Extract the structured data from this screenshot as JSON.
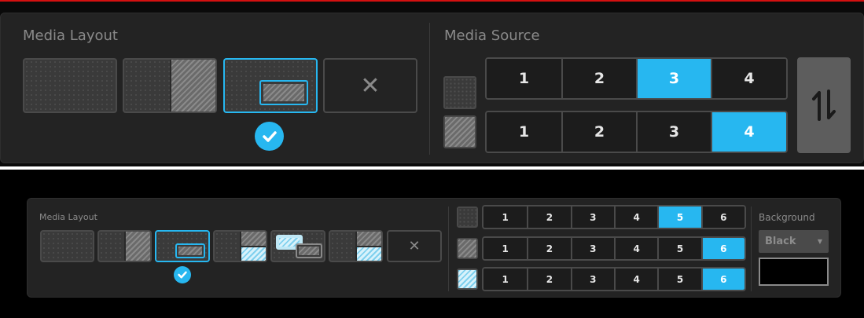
{
  "top": {
    "media_layout_label": "Media Layout",
    "media_source_label": "Media Source",
    "selected_layout_index": 2,
    "rows": [
      {
        "buttons": [
          "1",
          "2",
          "3",
          "4"
        ],
        "active": "3"
      },
      {
        "buttons": [
          "1",
          "2",
          "3",
          "4"
        ],
        "active": "4"
      }
    ],
    "close_glyph": "✕",
    "swap_glyph": "⇅"
  },
  "bottom": {
    "media_layout_label": "Media Layout",
    "background_label": "Background",
    "background_value": "Black",
    "selected_layout_index": 2,
    "rows": [
      {
        "buttons": [
          "1",
          "2",
          "3",
          "4",
          "5",
          "6"
        ],
        "active": "5"
      },
      {
        "buttons": [
          "1",
          "2",
          "3",
          "4",
          "5",
          "6"
        ],
        "active": "6"
      },
      {
        "buttons": [
          "1",
          "2",
          "3",
          "4",
          "5",
          "6"
        ],
        "active": "6"
      }
    ],
    "close_glyph": "✕"
  },
  "colors": {
    "accent": "#27b7f0",
    "panel": "#232323",
    "border": "#4a4a4a"
  },
  "icons": [
    "layout-fullscreen-icon",
    "layout-split-icon",
    "layout-pip-icon",
    "close-icon",
    "checkmark-icon",
    "swap-icon",
    "source-dots-icon",
    "source-hatch-icon",
    "source-blue-hatch-icon",
    "dropdown-caret-icon"
  ]
}
